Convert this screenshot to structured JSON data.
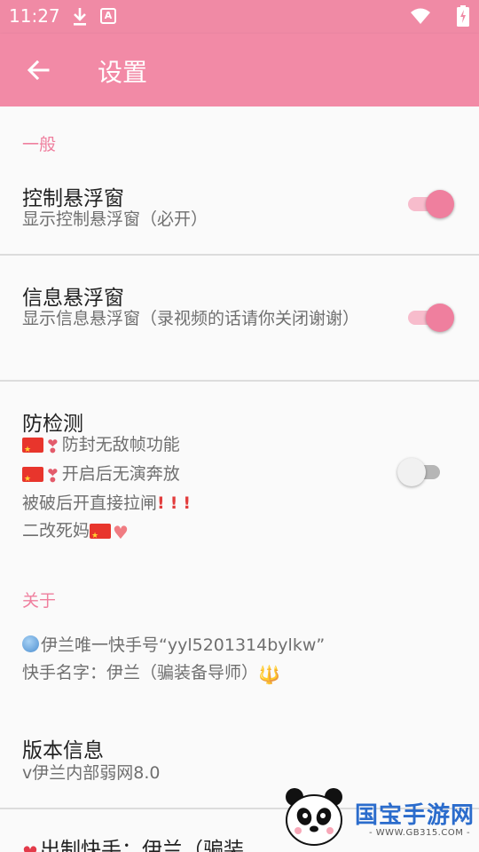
{
  "status_bar": {
    "time": "11:27",
    "icons": [
      "download-icon",
      "a-badge-icon",
      "wifi-icon",
      "battery-charging-icon"
    ],
    "a_badge": "A"
  },
  "app_bar": {
    "title": "设置",
    "back_icon": "arrow-back-icon",
    "color": "#f28aa6"
  },
  "sections": {
    "general": {
      "header": "一般",
      "floating_control": {
        "title": "控制悬浮窗",
        "summary": "显示控制悬浮窗（必开）",
        "enabled": true
      },
      "floating_info": {
        "title": "信息悬浮窗",
        "summary": "显示信息悬浮窗（录视频的话请你关闭谢谢）",
        "enabled": true
      },
      "anti_detect": {
        "title": "防检测",
        "lines": [
          "防封无敌帧功能",
          "开启后无演奔放",
          "被破后开直接拉闸",
          "二改死妈"
        ],
        "enabled": false
      }
    },
    "about": {
      "header": "关于",
      "kuaishou_id": "伊兰唯一快手号“yyl5201314bylkw”",
      "kuaishou_name": "快手名字：伊兰（骗装备导师）",
      "version": {
        "title": "版本信息",
        "value": "v伊兰内部弱网8.0"
      },
      "maker": "出制快手：伊兰（骗装"
    }
  },
  "watermark": {
    "name": "国宝手游网",
    "url": "- WWW.GB315.COM -"
  },
  "colors": {
    "accent": "#ef7f9e",
    "status_bar": "#f08aa5",
    "text": "#212121",
    "summary": "#6f6f6f"
  }
}
